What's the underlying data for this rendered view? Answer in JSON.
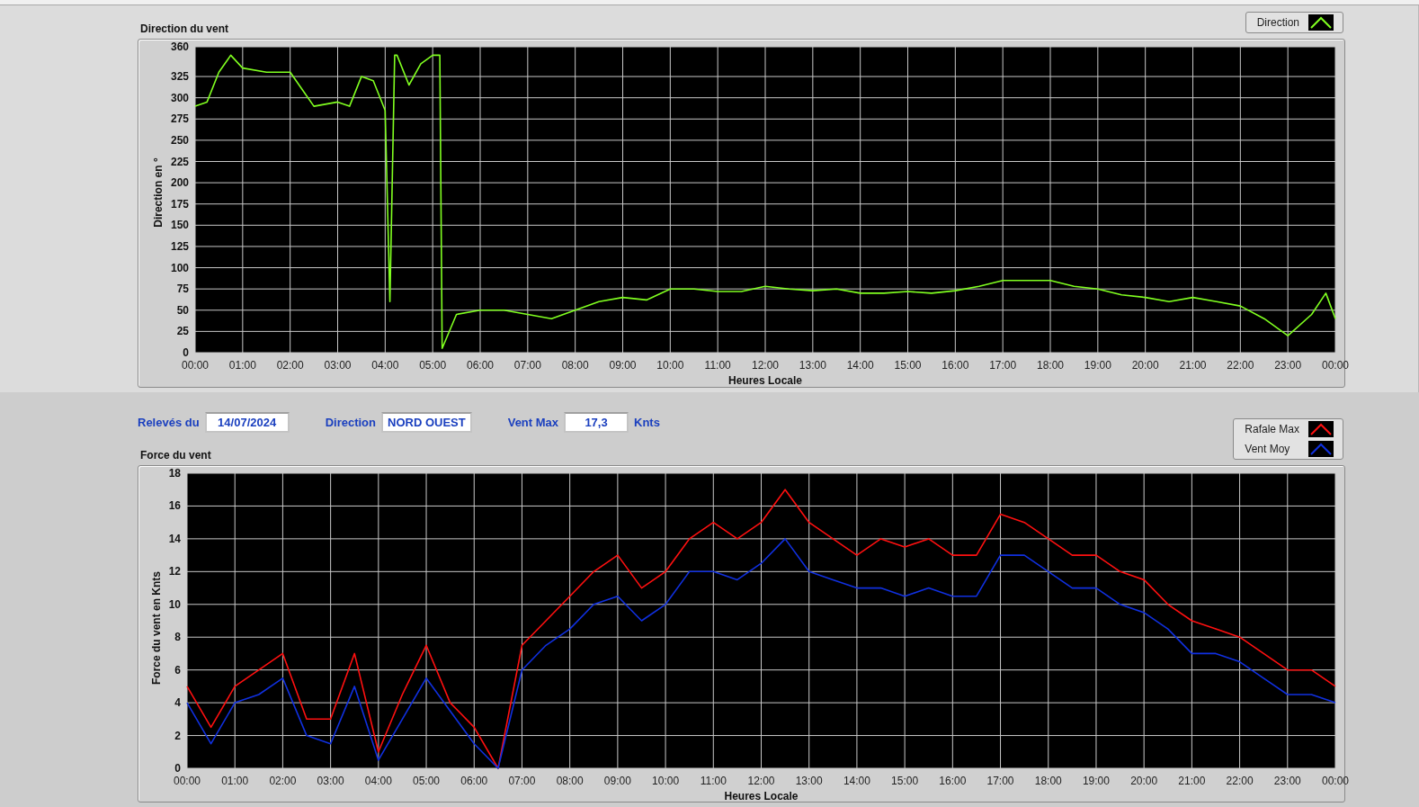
{
  "charts": [
    {
      "title": "Direction du vent",
      "chart_data": {
        "type": "line",
        "grid": true,
        "xlabel": "Heures Locale",
        "ylabel": "Direction en °",
        "xlim": [
          0,
          24
        ],
        "ylim": [
          0,
          360
        ],
        "x": [
          0,
          0.25,
          0.5,
          0.75,
          1,
          1.5,
          2,
          2.25,
          2.5,
          3,
          3.25,
          3.5,
          3.75,
          4,
          4.1,
          4.2,
          4.25,
          4.5,
          4.75,
          5,
          5.15,
          5.2,
          5.5,
          6,
          6.5,
          7,
          7.5,
          8,
          8.5,
          9,
          9.5,
          10,
          10.5,
          11,
          11.5,
          12,
          12.5,
          13,
          13.5,
          14,
          14.5,
          15,
          15.5,
          16,
          16.5,
          17,
          17.5,
          18,
          18.5,
          19,
          19.5,
          20,
          20.5,
          21,
          21.5,
          22,
          22.5,
          23,
          23.5,
          23.8,
          24
        ],
        "series": [
          {
            "name": "Direction",
            "color": "#80ff20",
            "values": [
              290,
              295,
              330,
              350,
              335,
              330,
              330,
              310,
              290,
              295,
              290,
              325,
              320,
              285,
              60,
              350,
              350,
              315,
              340,
              350,
              350,
              5,
              45,
              50,
              50,
              45,
              40,
              50,
              60,
              65,
              62,
              75,
              75,
              72,
              72,
              78,
              75,
              73,
              75,
              70,
              70,
              72,
              70,
              73,
              78,
              85,
              85,
              85,
              78,
              75,
              68,
              65,
              60,
              65,
              60,
              55,
              40,
              20,
              45,
              70,
              40
            ]
          }
        ],
        "yticks": [
          0,
          25,
          50,
          75,
          100,
          125,
          150,
          175,
          200,
          225,
          250,
          275,
          300,
          325,
          360
        ],
        "xticks": [
          {
            "value": 0,
            "label": "00:00"
          },
          {
            "value": 1,
            "label": "01:00"
          },
          {
            "value": 2,
            "label": "02:00"
          },
          {
            "value": 3,
            "label": "03:00"
          },
          {
            "value": 4,
            "label": "04:00"
          },
          {
            "value": 5,
            "label": "05:00"
          },
          {
            "value": 6,
            "label": "06:00"
          },
          {
            "value": 7,
            "label": "07:00"
          },
          {
            "value": 8,
            "label": "08:00"
          },
          {
            "value": 9,
            "label": "09:00"
          },
          {
            "value": 10,
            "label": "10:00"
          },
          {
            "value": 11,
            "label": "11:00"
          },
          {
            "value": 12,
            "label": "12:00"
          },
          {
            "value": 13,
            "label": "13:00"
          },
          {
            "value": 14,
            "label": "14:00"
          },
          {
            "value": 15,
            "label": "15:00"
          },
          {
            "value": 16,
            "label": "16:00"
          },
          {
            "value": 17,
            "label": "17:00"
          },
          {
            "value": 18,
            "label": "18:00"
          },
          {
            "value": 19,
            "label": "19:00"
          },
          {
            "value": 20,
            "label": "20:00"
          },
          {
            "value": 21,
            "label": "21:00"
          },
          {
            "value": 22,
            "label": "22:00"
          },
          {
            "value": 23,
            "label": "23:00"
          },
          {
            "value": 24,
            "label": "00:00"
          }
        ]
      }
    },
    {
      "title": "Force du vent",
      "chart_data": {
        "type": "line",
        "grid": true,
        "xlabel": "Heures Locale",
        "ylabel": "Force du vent en Knts",
        "xlim": [
          0,
          24
        ],
        "ylim": [
          0,
          18
        ],
        "x": [
          0,
          0.5,
          1,
          1.5,
          2,
          2.5,
          3,
          3.5,
          4,
          4.5,
          5,
          5.5,
          6,
          6.5,
          7,
          7.5,
          8,
          8.5,
          9,
          9.5,
          10,
          10.5,
          11,
          11.5,
          12,
          12.5,
          13,
          13.5,
          14,
          14.5,
          15,
          15.5,
          16,
          16.5,
          17,
          17.5,
          18,
          18.5,
          19,
          19.5,
          20,
          20.5,
          21,
          21.5,
          22,
          22.5,
          23,
          23.5,
          24
        ],
        "series": [
          {
            "name": "Rafale Max",
            "color": "#ff1010",
            "values": [
              5,
              2.5,
              5,
              6,
              7,
              3,
              3,
              7,
              1,
              4.5,
              7.5,
              4,
              2.5,
              0,
              7.5,
              9,
              10.5,
              12,
              13,
              11,
              12,
              14,
              15,
              14,
              15,
              17,
              15,
              14,
              13,
              14,
              13.5,
              14,
              13,
              13,
              15.5,
              15,
              14,
              13,
              13,
              12,
              11.5,
              10,
              9,
              8.5,
              8,
              7,
              6,
              6,
              5
            ]
          },
          {
            "name": "Vent Moy",
            "color": "#1030e0",
            "values": [
              4,
              1.5,
              4,
              4.5,
              5.5,
              2,
              1.5,
              5,
              0.5,
              3,
              5.5,
              3.5,
              1.5,
              0,
              6,
              7.5,
              8.5,
              10,
              10.5,
              9,
              10,
              12,
              12,
              11.5,
              12.5,
              14,
              12,
              11.5,
              11,
              11,
              10.5,
              11,
              10.5,
              10.5,
              13,
              13,
              12,
              11,
              11,
              10,
              9.5,
              8.5,
              7,
              7,
              6.5,
              5.5,
              4.5,
              4.5,
              4
            ]
          }
        ],
        "yticks": [
          0,
          2,
          4,
          6,
          8,
          10,
          12,
          14,
          16,
          18
        ],
        "xticks": [
          {
            "value": 0,
            "label": "00:00"
          },
          {
            "value": 1,
            "label": "01:00"
          },
          {
            "value": 2,
            "label": "02:00"
          },
          {
            "value": 3,
            "label": "03:00"
          },
          {
            "value": 4,
            "label": "04:00"
          },
          {
            "value": 5,
            "label": "05:00"
          },
          {
            "value": 6,
            "label": "06:00"
          },
          {
            "value": 7,
            "label": "07:00"
          },
          {
            "value": 8,
            "label": "08:00"
          },
          {
            "value": 9,
            "label": "09:00"
          },
          {
            "value": 10,
            "label": "10:00"
          },
          {
            "value": 11,
            "label": "11:00"
          },
          {
            "value": 12,
            "label": "12:00"
          },
          {
            "value": 13,
            "label": "13:00"
          },
          {
            "value": 14,
            "label": "14:00"
          },
          {
            "value": 15,
            "label": "15:00"
          },
          {
            "value": 16,
            "label": "16:00"
          },
          {
            "value": 17,
            "label": "17:00"
          },
          {
            "value": 18,
            "label": "18:00"
          },
          {
            "value": 19,
            "label": "19:00"
          },
          {
            "value": 20,
            "label": "20:00"
          },
          {
            "value": 21,
            "label": "21:00"
          },
          {
            "value": 22,
            "label": "22:00"
          },
          {
            "value": 23,
            "label": "23:00"
          },
          {
            "value": 24,
            "label": "00:00"
          }
        ]
      }
    }
  ],
  "readings": [
    {
      "label": "Relevés du",
      "value": "14/07/2024"
    },
    {
      "label": "Direction",
      "value": "NORD OUEST"
    },
    {
      "label": "Vent Max",
      "value": "17,3",
      "unit": "Knts"
    }
  ]
}
